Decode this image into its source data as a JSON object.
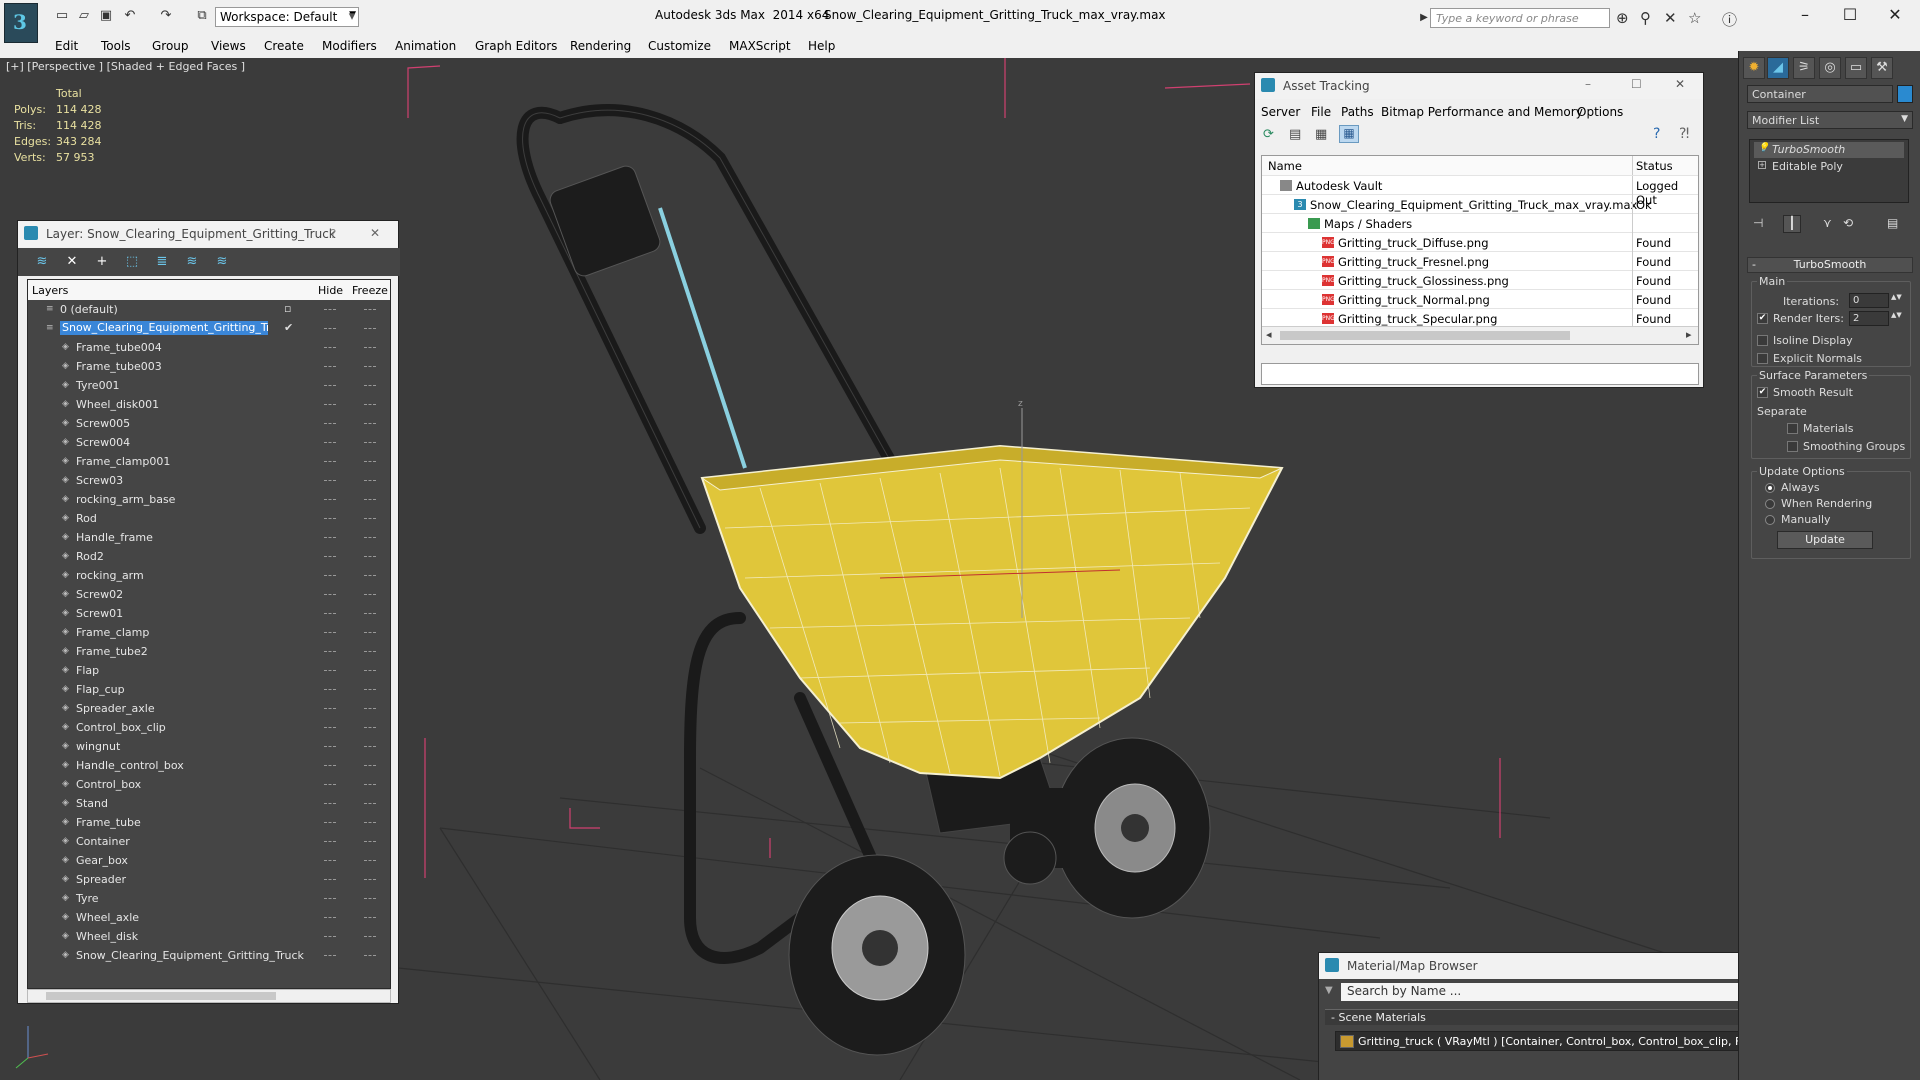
{
  "titlebar": {
    "app_title": "Autodesk 3ds Max  2014 x64",
    "file_title": "Snow_Clearing_Equipment_Gritting_Truck_max_vray.max",
    "workspace": "Workspace: Default",
    "search_placeholder": "Type a keyword or phrase"
  },
  "menu": [
    "Edit",
    "Tools",
    "Group",
    "Views",
    "Create",
    "Modifiers",
    "Animation",
    "Graph Editors",
    "Rendering",
    "Customize",
    "MAXScript",
    "Help"
  ],
  "viewport": {
    "label": "[+] [Perspective ] [Shaded + Edged Faces ]",
    "stats_header": "Total",
    "stats": [
      {
        "k": "Polys:",
        "v": "114 428"
      },
      {
        "k": "Tris:",
        "v": "114 428"
      },
      {
        "k": "Edges:",
        "v": "343 284"
      },
      {
        "k": "Verts:",
        "v": "57 953"
      }
    ],
    "colors": {
      "hopper": "#e0c63a",
      "frame": "#222222",
      "bbox": "#d04070"
    }
  },
  "layer_panel": {
    "title": "Layer: Snow_Clearing_Equipment_Gritting_Truck",
    "help": "?",
    "close": "✕",
    "col_layers": "Layers",
    "col_hide": "Hide",
    "col_freeze": "Freeze",
    "rows": [
      {
        "name": "0 (default)",
        "level": 0
      },
      {
        "name": "Snow_Clearing_Equipment_Gritting_Truck",
        "level": 0,
        "selected": true
      },
      {
        "name": "Frame_tube004",
        "level": 1
      },
      {
        "name": "Frame_tube003",
        "level": 1
      },
      {
        "name": "Tyre001",
        "level": 1
      },
      {
        "name": "Wheel_disk001",
        "level": 1
      },
      {
        "name": "Screw005",
        "level": 1
      },
      {
        "name": "Screw004",
        "level": 1
      },
      {
        "name": "Frame_clamp001",
        "level": 1
      },
      {
        "name": "Screw03",
        "level": 1
      },
      {
        "name": "rocking_arm_base",
        "level": 1
      },
      {
        "name": "Rod",
        "level": 1
      },
      {
        "name": "Handle_frame",
        "level": 1
      },
      {
        "name": "Rod2",
        "level": 1
      },
      {
        "name": "rocking_arm",
        "level": 1
      },
      {
        "name": "Screw02",
        "level": 1
      },
      {
        "name": "Screw01",
        "level": 1
      },
      {
        "name": "Frame_clamp",
        "level": 1
      },
      {
        "name": "Frame_tube2",
        "level": 1
      },
      {
        "name": "Flap",
        "level": 1
      },
      {
        "name": "Flap_cup",
        "level": 1
      },
      {
        "name": "Spreader_axle",
        "level": 1
      },
      {
        "name": "Control_box_clip",
        "level": 1
      },
      {
        "name": "wingnut",
        "level": 1
      },
      {
        "name": "Handle_control_box",
        "level": 1
      },
      {
        "name": "Control_box",
        "level": 1
      },
      {
        "name": "Stand",
        "level": 1
      },
      {
        "name": "Frame_tube",
        "level": 1
      },
      {
        "name": "Container",
        "level": 1
      },
      {
        "name": "Gear_box",
        "level": 1
      },
      {
        "name": "Spreader",
        "level": 1
      },
      {
        "name": "Tyre",
        "level": 1
      },
      {
        "name": "Wheel_axle",
        "level": 1
      },
      {
        "name": "Wheel_disk",
        "level": 1
      },
      {
        "name": "Snow_Clearing_Equipment_Gritting_Truck",
        "level": 1
      }
    ]
  },
  "asset_panel": {
    "title": "Asset Tracking",
    "menu": [
      "Server",
      "File",
      "Paths",
      "Bitmap Performance and Memory",
      "Options"
    ],
    "col_name": "Name",
    "col_status": "Status",
    "rows": [
      {
        "name": "Autodesk Vault",
        "status": "Logged Out",
        "level": 1,
        "icon": "vault"
      },
      {
        "name": "Snow_Clearing_Equipment_Gritting_Truck_max_vray.max",
        "status": "Ok",
        "level": 2,
        "icon": "max"
      },
      {
        "name": "Maps / Shaders",
        "status": "",
        "level": 3,
        "icon": "maps"
      },
      {
        "name": "Gritting_truck_Diffuse.png",
        "status": "Found",
        "level": 4,
        "icon": "png"
      },
      {
        "name": "Gritting_truck_Fresnel.png",
        "status": "Found",
        "level": 4,
        "icon": "png"
      },
      {
        "name": "Gritting_truck_Glossiness.png",
        "status": "Found",
        "level": 4,
        "icon": "png"
      },
      {
        "name": "Gritting_truck_Normal.png",
        "status": "Found",
        "level": 4,
        "icon": "png"
      },
      {
        "name": "Gritting_truck_Specular.png",
        "status": "Found",
        "level": 4,
        "icon": "png"
      }
    ]
  },
  "material_panel": {
    "title": "Material/Map Browser",
    "search_placeholder": "Search by Name ...",
    "section": "- Scene Materials",
    "item": "Gritting_truck  ( VRayMtl )  [Container, Control_box, Control_box_clip, Flap, Flap_cup, Frame_clamp, Fr..."
  },
  "command_panel": {
    "object_name": "Container",
    "modifier_list": "Modifier List",
    "stack": [
      {
        "name": "TurboSmooth",
        "italic": true
      },
      {
        "name": "Editable Poly",
        "italic": false
      }
    ],
    "rollout_title": "TurboSmooth",
    "main_label": "Main",
    "iterations_label": "Iterations:",
    "iterations_value": "0",
    "render_iters_label": "Render Iters:",
    "render_iters_value": "2",
    "render_iters_checked": true,
    "isoline_label": "Isoline Display",
    "explicit_normals_label": "Explicit Normals",
    "surface_params_label": "Surface Parameters",
    "smooth_result_label": "Smooth Result",
    "separate_label": "Separate",
    "materials_label": "Materials",
    "smoothing_groups_label": "Smoothing Groups",
    "update_options_label": "Update Options",
    "always_label": "Always",
    "when_rendering_label": "When Rendering",
    "manually_label": "Manually",
    "update_button": "Update"
  }
}
